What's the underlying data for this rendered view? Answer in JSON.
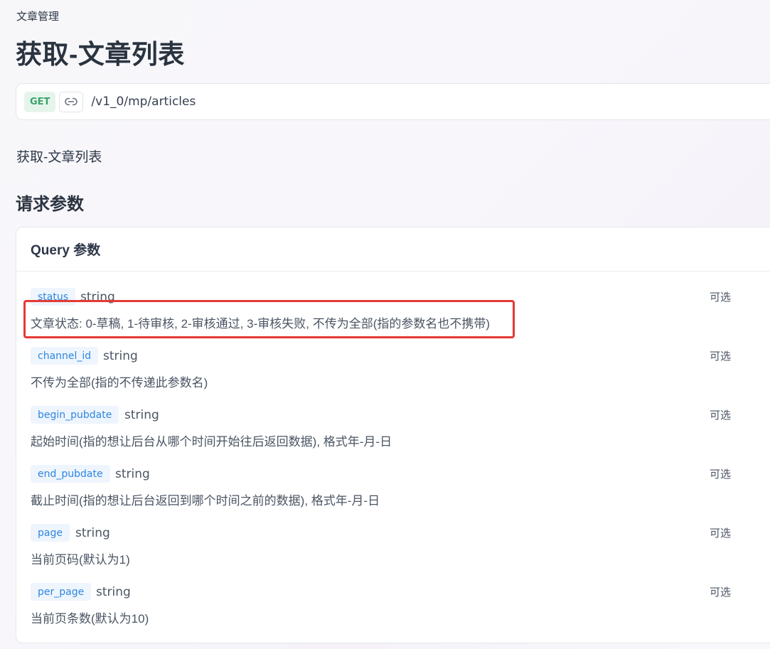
{
  "breadcrumb": "文章管理",
  "page_title": "获取-文章列表",
  "endpoint": {
    "method": "GET",
    "path": "/v1_0/mp/articles"
  },
  "description": "获取-文章列表",
  "section_title": "请求参数",
  "query_card": {
    "title": "Query 参数",
    "params": [
      {
        "name": "status",
        "type": "string",
        "optional": "可选",
        "desc": "文章状态: 0-草稿, 1-待审核, 2-审核通过, 3-审核失败, 不传为全部(指的参数名也不携带)"
      },
      {
        "name": "channel_id",
        "type": "string",
        "optional": "可选",
        "desc": "不传为全部(指的不传递此参数名)"
      },
      {
        "name": "begin_pubdate",
        "type": "string",
        "optional": "可选",
        "desc": "起始时间(指的想让后台从哪个时间开始往后返回数据), 格式年-月-日"
      },
      {
        "name": "end_pubdate",
        "type": "string",
        "optional": "可选",
        "desc": "截止时间(指的想让后台返回到哪个时间之前的数据), 格式年-月-日"
      },
      {
        "name": "page",
        "type": "string",
        "optional": "可选",
        "desc": "当前页码(默认为1)"
      },
      {
        "name": "per_page",
        "type": "string",
        "optional": "可选",
        "desc": "当前页条数(默认为10)"
      }
    ]
  },
  "icons": {
    "link": "link-icon"
  },
  "colors": {
    "method_bg": "#e6f5ec",
    "method_text": "#3aa36b",
    "param_bg": "#eef5fd",
    "param_text": "#2f86e0",
    "highlight": "#e53935"
  }
}
